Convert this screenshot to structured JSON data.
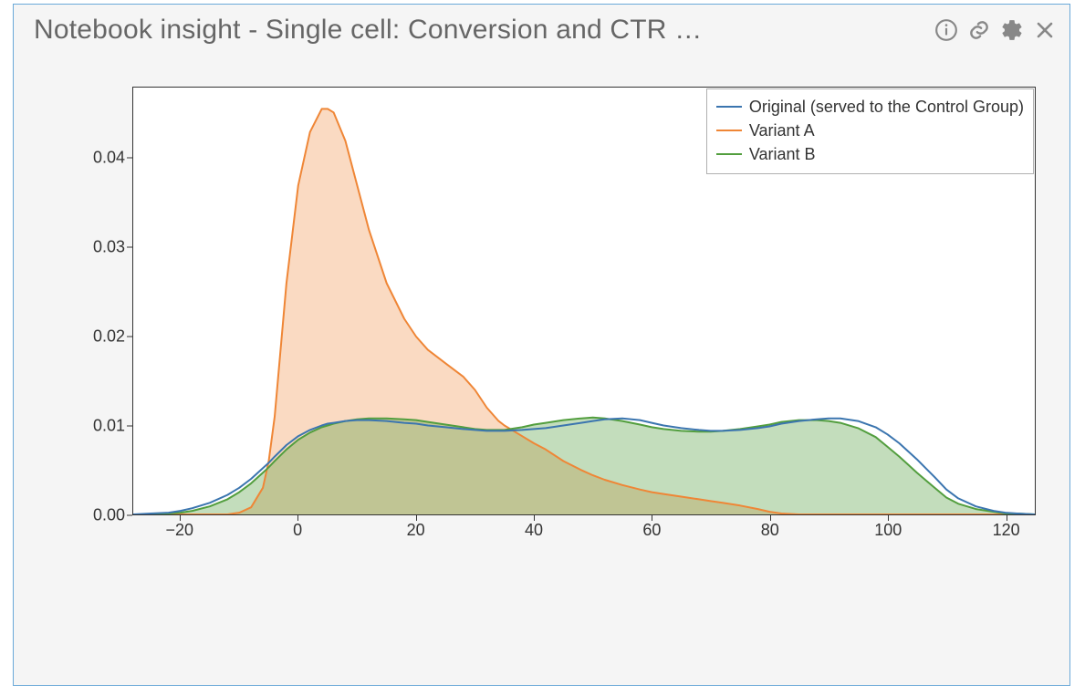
{
  "panel": {
    "title": "Notebook insight - Single cell: Conversion and CTR …",
    "icons": [
      "info-icon",
      "link-icon",
      "gear-icon",
      "close-icon"
    ]
  },
  "chart_data": {
    "type": "area",
    "title": "",
    "xlabel": "",
    "ylabel": "",
    "xlim": [
      -28,
      125
    ],
    "ylim": [
      0,
      0.048
    ],
    "x_ticks": [
      -20,
      0,
      20,
      40,
      60,
      80,
      100,
      120
    ],
    "y_ticks": [
      0.0,
      0.01,
      0.02,
      0.03,
      0.04
    ],
    "y_tick_labels": [
      "0.00",
      "0.01",
      "0.02",
      "0.03",
      "0.04"
    ],
    "legend": {
      "position": "upper right",
      "entries": [
        "Original (served to the Control Group)",
        "Variant A",
        "Variant B"
      ]
    },
    "colors": {
      "Original (served to the Control Group)": "#3b75af",
      "Variant A": "#ef8636",
      "Variant B": "#529e3e"
    },
    "x": [
      -28,
      -25,
      -22,
      -20,
      -18,
      -15,
      -12,
      -10,
      -8,
      -6,
      -5,
      -4,
      -2,
      0,
      2,
      4,
      5,
      6,
      8,
      10,
      12,
      15,
      18,
      20,
      22,
      25,
      28,
      30,
      32,
      34,
      35,
      38,
      40,
      42,
      45,
      48,
      50,
      52,
      55,
      58,
      60,
      62,
      65,
      68,
      70,
      72,
      75,
      78,
      80,
      82,
      85,
      88,
      90,
      92,
      95,
      98,
      100,
      102,
      105,
      108,
      110,
      112,
      115,
      118,
      120,
      122,
      125
    ],
    "series": [
      {
        "name": "Original (served to the Control Group)",
        "values": [
          0.0,
          0.0001,
          0.0002,
          0.0004,
          0.0007,
          0.0013,
          0.0022,
          0.003,
          0.004,
          0.0052,
          0.0058,
          0.0065,
          0.0078,
          0.0088,
          0.0095,
          0.01,
          0.0102,
          0.0103,
          0.0105,
          0.0106,
          0.0106,
          0.0105,
          0.0103,
          0.0102,
          0.01,
          0.0098,
          0.0096,
          0.0095,
          0.0094,
          0.0094,
          0.0094,
          0.0095,
          0.0096,
          0.0097,
          0.01,
          0.0103,
          0.0105,
          0.0107,
          0.0108,
          0.0106,
          0.0103,
          0.01,
          0.0097,
          0.0095,
          0.0094,
          0.0094,
          0.0095,
          0.0097,
          0.0099,
          0.0102,
          0.0105,
          0.0107,
          0.0108,
          0.0108,
          0.0105,
          0.0098,
          0.009,
          0.008,
          0.0062,
          0.0042,
          0.0028,
          0.0018,
          0.0009,
          0.0004,
          0.0002,
          0.0001,
          0.0
        ]
      },
      {
        "name": "Variant A",
        "values": [
          0.0,
          0.0,
          0.0,
          0.0,
          0.0,
          0.0,
          0.0,
          0.0002,
          0.0008,
          0.003,
          0.006,
          0.011,
          0.026,
          0.037,
          0.043,
          0.0456,
          0.0456,
          0.0452,
          0.042,
          0.037,
          0.032,
          0.026,
          0.022,
          0.02,
          0.0185,
          0.017,
          0.0155,
          0.014,
          0.012,
          0.0105,
          0.01,
          0.0088,
          0.008,
          0.0073,
          0.006,
          0.005,
          0.0044,
          0.0039,
          0.0033,
          0.0028,
          0.0025,
          0.0023,
          0.002,
          0.0017,
          0.0015,
          0.0013,
          0.001,
          0.0006,
          0.0003,
          0.0001,
          0.0,
          0.0,
          0.0,
          0.0,
          0.0,
          0.0,
          0.0,
          0.0,
          0.0,
          0.0,
          0.0,
          0.0,
          0.0,
          0.0,
          0.0,
          0.0,
          0.0
        ]
      },
      {
        "name": "Variant B",
        "values": [
          0.0,
          0.0,
          0.0001,
          0.0002,
          0.0004,
          0.0009,
          0.0017,
          0.0025,
          0.0035,
          0.0047,
          0.0053,
          0.006,
          0.0073,
          0.0084,
          0.0092,
          0.0098,
          0.01,
          0.0102,
          0.0105,
          0.0107,
          0.0108,
          0.0108,
          0.0107,
          0.0106,
          0.0104,
          0.0101,
          0.0098,
          0.0096,
          0.0095,
          0.0095,
          0.0095,
          0.0098,
          0.0101,
          0.0103,
          0.0106,
          0.0108,
          0.0109,
          0.0108,
          0.0105,
          0.0101,
          0.0098,
          0.0096,
          0.0094,
          0.0093,
          0.0093,
          0.0094,
          0.0096,
          0.0099,
          0.0101,
          0.0104,
          0.0106,
          0.0106,
          0.0105,
          0.0103,
          0.0097,
          0.0087,
          0.0076,
          0.0065,
          0.0047,
          0.003,
          0.0019,
          0.0012,
          0.0006,
          0.0003,
          0.0001,
          0.0001,
          0.0
        ]
      }
    ]
  }
}
